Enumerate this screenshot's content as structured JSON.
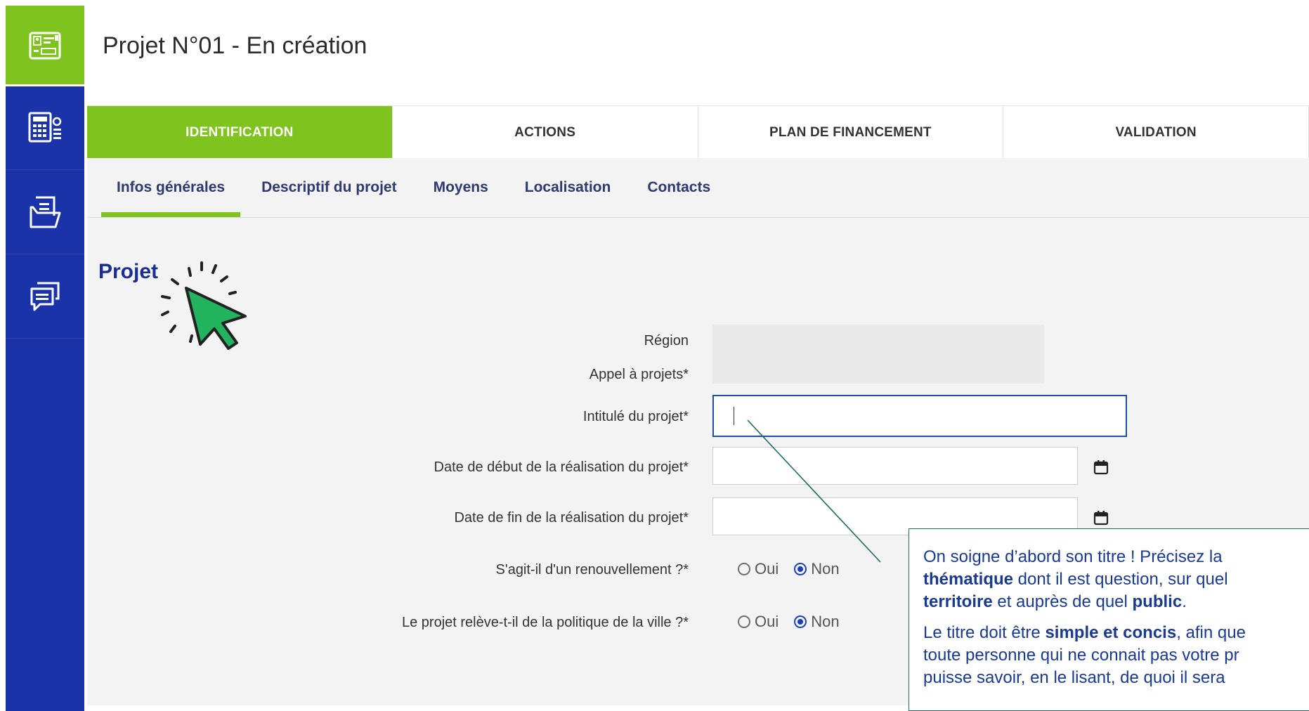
{
  "sidebar": {
    "items": [
      {
        "icon": "id-card-icon",
        "active": true
      },
      {
        "icon": "calculator-icon",
        "active": false
      },
      {
        "icon": "folder-document-icon",
        "active": false
      },
      {
        "icon": "chat-icon",
        "active": false
      }
    ],
    "color": "#1a33a8",
    "active_color": "#7fc31f"
  },
  "header": {
    "title": "Projet N°01 - En création"
  },
  "tabs": [
    {
      "label": "IDENTIFICATION",
      "active": true
    },
    {
      "label": "ACTIONS",
      "active": false
    },
    {
      "label": "PLAN DE FINANCEMENT",
      "active": false
    },
    {
      "label": "VALIDATION",
      "active": false
    }
  ],
  "subtabs": [
    {
      "label": "Infos générales",
      "active": true
    },
    {
      "label": "Descriptif du projet",
      "active": false
    },
    {
      "label": "Moyens",
      "active": false
    },
    {
      "label": "Localisation",
      "active": false
    },
    {
      "label": "Contacts",
      "active": false
    }
  ],
  "section": {
    "title": "Projet"
  },
  "form": {
    "region_label": "Région",
    "appel_label": "Appel à projets*",
    "intitule_label": "Intitulé du projet*",
    "intitule_value": "",
    "date_debut_label": "Date de début de la réalisation du projet*",
    "date_debut_value": "",
    "date_fin_label": "Date de fin de la réalisation du projet*",
    "date_fin_value": "",
    "renouvellement_label": "S'agit-il d'un renouvellement ?*",
    "politique_label": "Le projet relève-t-il de la politique de la ville ?*",
    "opt_oui": "Oui",
    "opt_non": "Non",
    "renouvellement_selected": "Non",
    "politique_selected": "Non"
  },
  "callout": {
    "p1_a": "On soigne d’abord son titre ! Précisez la",
    "p1_b_bold": "thématique",
    "p1_b_rest": " dont il est question, sur quel",
    "p1_c_bold": "territoire",
    "p1_c_mid": " et auprès de quel ",
    "p1_c_bold2": "public",
    "p1_c_end": ".",
    "p2_a": "Le titre doit être ",
    "p2_a_bold": "simple et concis",
    "p2_a_rest": ", afin que",
    "p2_b": "toute personne qui ne connait pas votre pr",
    "p2_c": "puisse savoir, en le lisant, de quoi il sera"
  },
  "colors": {
    "accent_green": "#7fc31f",
    "brand_blue": "#1a33a8",
    "heading_blue": "#1a2e8f",
    "cursor_green": "#22b35f"
  }
}
